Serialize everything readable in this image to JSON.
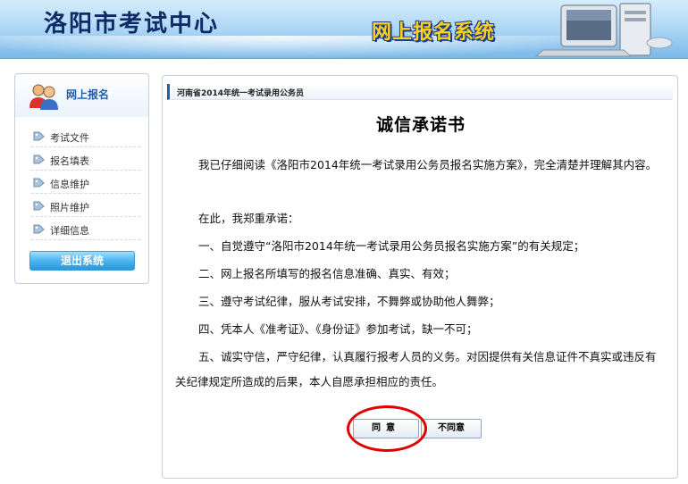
{
  "header": {
    "site_title": "洛阳市考试中心",
    "system_title": "网上报名系统"
  },
  "sidebar": {
    "title": "网上报名",
    "items": [
      {
        "label": "考试文件",
        "icon": "tag-icon"
      },
      {
        "label": "报名填表",
        "icon": "tag-icon"
      },
      {
        "label": "信息维护",
        "icon": "tag-icon"
      },
      {
        "label": "照片维护",
        "icon": "tag-icon"
      },
      {
        "label": "详细信息",
        "icon": "tag-icon"
      }
    ],
    "logout_label": "退出系统"
  },
  "main": {
    "breadcrumb": "河南省2014年统一考试录用公务员",
    "doc_title": "诚信承诺书",
    "paragraphs": [
      "我已仔细阅读《洛阳市2014年统一考试录用公务员报名实施方案》，完全清楚并理解其内容。",
      "在此，我郑重承诺：",
      "一、自觉遵守“洛阳市2014年统一考试录用公务员报名实施方案”的有关规定；",
      "二、网上报名所填写的报名信息准确、真实、有效；",
      "三、遵守考试纪律，服从考试安排，不舞弊或协助他人舞弊；",
      "四、凭本人《准考证》、《身份证》参加考试，缺一不可；",
      "五、诚实守信，严守纪律，认真履行报考人员的义务。对因提供有关信息证件不真实或违反有关纪律规定所造成的后果，本人自愿承担相应的责任。"
    ],
    "agree_label": "同意",
    "disagree_label": "不同意"
  },
  "colors": {
    "header_blue": "#7ab9e8",
    "title_navy": "#0f2a66",
    "system_title_yellow": "#ffd21a",
    "link_blue": "#1f5fa8",
    "highlight_red": "#e00000"
  }
}
